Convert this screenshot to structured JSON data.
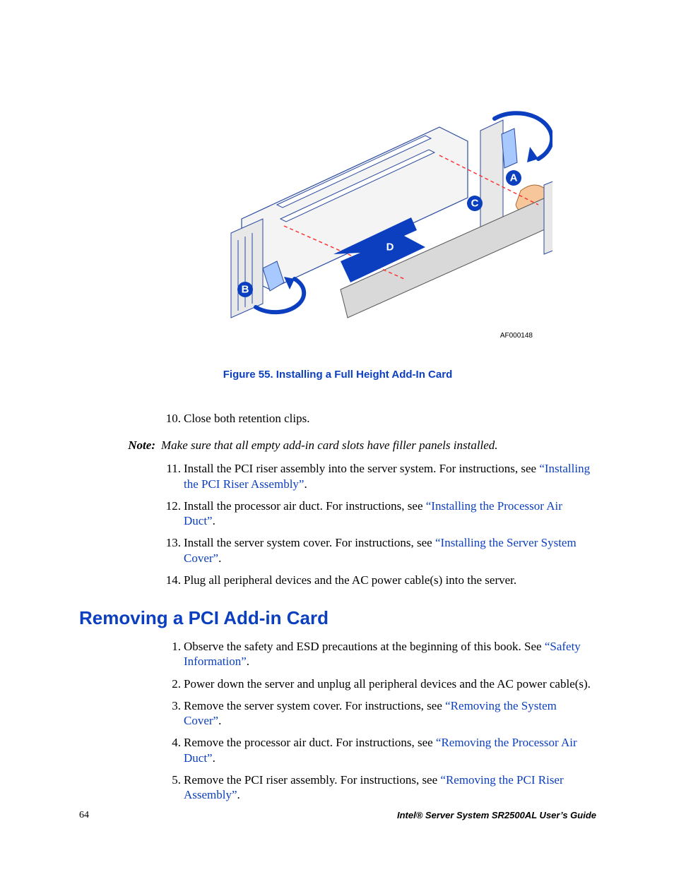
{
  "figure": {
    "image_code": "AF000148",
    "caption": "Figure 55. Installing a Full Height Add-In Card",
    "labels": {
      "A": "A",
      "B": "B",
      "C": "C",
      "D": "D"
    }
  },
  "steps_before_note": [
    {
      "n": "10.",
      "text": "Close both retention clips."
    }
  ],
  "note": {
    "label": "Note:",
    "text": "Make sure that all empty add-in card slots have filler panels installed."
  },
  "steps_after_note": [
    {
      "n": "11.",
      "pre": "Install the PCI riser assembly into the server system. For instructions, see ",
      "link": "“Installing the PCI Riser Assembly”",
      "post": "."
    },
    {
      "n": "12.",
      "pre": "Install the processor air duct. For instructions, see ",
      "link": "“Installing the Processor Air Duct”",
      "post": "."
    },
    {
      "n": "13.",
      "pre": "Install the server system cover. For instructions, see ",
      "link": "“Installing the Server System Cover”",
      "post": "."
    },
    {
      "n": "14.",
      "pre": "Plug all peripheral devices and the AC power cable(s) into the server.",
      "link": "",
      "post": ""
    }
  ],
  "heading": "Removing a PCI Add-in Card",
  "steps_section2": [
    {
      "n": "1.",
      "pre": "Observe the safety and ESD precautions at the beginning of this book. See ",
      "link": "“Safety Information”",
      "post": "."
    },
    {
      "n": "2.",
      "pre": "Power down the server and unplug all peripheral devices and the AC power cable(s).",
      "link": "",
      "post": ""
    },
    {
      "n": "3.",
      "pre": "Remove the server system cover. For instructions, see ",
      "link": "“Removing the System Cover”",
      "post": "."
    },
    {
      "n": "4.",
      "pre": "Remove the processor air duct. For instructions, see ",
      "link": "“Removing the Processor Air Duct”",
      "post": "."
    },
    {
      "n": "5.",
      "pre": "Remove the PCI riser assembly. For instructions, see ",
      "link": "“Removing the PCI Riser Assembly”",
      "post": "."
    }
  ],
  "footer": {
    "page": "64",
    "title": "Intel® Server System SR2500AL User’s Guide"
  }
}
